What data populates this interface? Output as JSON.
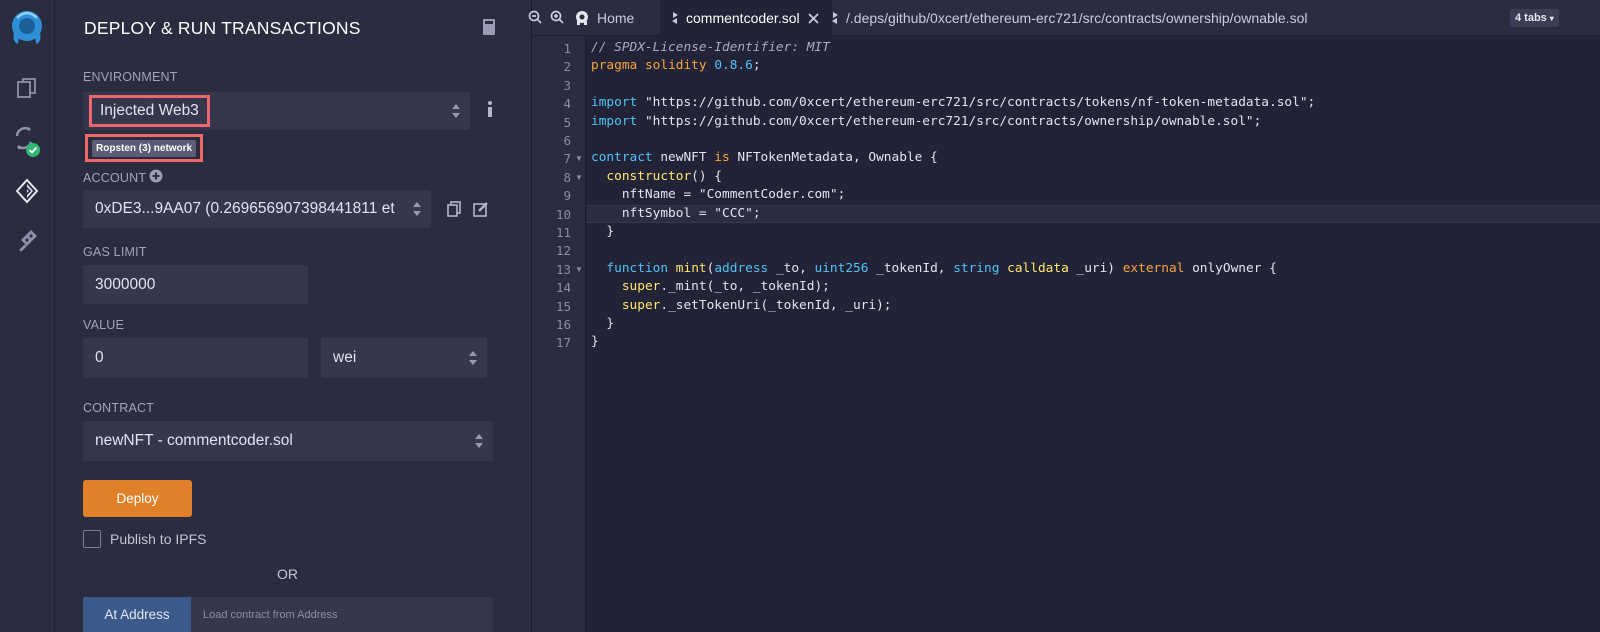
{
  "rail": {
    "icons": [
      "remix-logo-icon",
      "file-explorer-icon",
      "solidity-compiler-icon",
      "deploy-run-icon",
      "plugin-manager-icon"
    ]
  },
  "panel": {
    "title": "DEPLOY & RUN TRANSACTIONS",
    "environment": {
      "label": "ENVIRONMENT",
      "value": "Injected Web3",
      "network_badge": "Ropsten (3) network"
    },
    "account": {
      "label": "ACCOUNT",
      "value": "0xDE3...9AA07 (0.26965690739844181​1 et"
    },
    "gas_limit": {
      "label": "GAS LIMIT",
      "value": "3000000"
    },
    "value": {
      "label": "VALUE",
      "amount": "0",
      "unit": "wei"
    },
    "contract": {
      "label": "CONTRACT",
      "value": "newNFT - commentcoder.sol"
    },
    "deploy_label": "Deploy",
    "publish_label": "Publish to IPFS",
    "or_label": "OR",
    "at_address_label": "At Address",
    "at_address_placeholder": "Load contract from Address"
  },
  "editor": {
    "tabs": {
      "home": "Home",
      "active_file": "commentcoder.sol",
      "other_file": "/.deps/github/0xcert/ethereum-erc721/src/contracts/ownership/ownable.sol",
      "count_badge": "4 tabs"
    },
    "active_line": 10,
    "code_lines": [
      "// SPDX-License-Identifier: MIT",
      "pragma solidity 0.8.6;",
      "",
      "import \"https://github.com/0xcert/ethereum-erc721/src/contracts/tokens/nf-token-metadata.sol\";",
      "import \"https://github.com/0xcert/ethereum-erc721/src/contracts/ownership/ownable.sol\";",
      "",
      "contract newNFT is NFTokenMetadata, Ownable {",
      "  constructor() {",
      "    nftName = \"CommentCoder.com\";",
      "    nftSymbol = \"CCC\";",
      "  }",
      "",
      "  function mint(address _to, uint256 _tokenId, string calldata _uri) external onlyOwner {",
      "    super._mint(_to, _tokenId);",
      "    super._setTokenUri(_tokenId, _uri);",
      "  }",
      "}"
    ],
    "line_numbers": [
      "1",
      "2",
      "3",
      "4",
      "5",
      "6",
      "7",
      "8",
      "9",
      "10",
      "11",
      "12",
      "13",
      "14",
      "15",
      "16",
      "17"
    ]
  },
  "colors": {
    "accent_orange": "#e0812a",
    "highlight_red": "#f0666d",
    "panel_bg": "#2a2c3f",
    "editor_bg": "#222336",
    "field_bg": "#35384c"
  }
}
